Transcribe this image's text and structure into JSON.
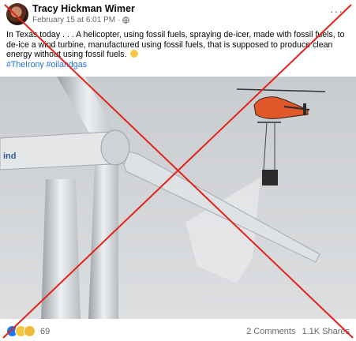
{
  "post": {
    "author": "Tracy Hickman Wimer",
    "date": "February 15 at 6:01 PM",
    "separator": "·",
    "more_label": "···",
    "text": "In Texas today . . . A helicopter, using fossil fuels, spraying de-icer, made with fossil fuels, to de-ice a wind turbine, manufactured using fossil fuels, that is supposed to produce clean energy without using fossil fuels.",
    "hashtags": "#TheIrony #oilandgas",
    "turbine_brand": "ind"
  },
  "footer": {
    "reaction_count": "69",
    "comments": "2 Comments",
    "shares": "1.1K Shares"
  },
  "colors": {
    "overlay_x": "#e2231a",
    "link": "#216fdb",
    "secondary_text": "#65676b",
    "helicopter_orange": "#e0582a"
  },
  "icons": {
    "globe": "globe-icon",
    "more": "more-options-icon",
    "like": "like-reaction-icon",
    "haha": "haha-reaction-icon",
    "wow": "wow-reaction-icon"
  }
}
